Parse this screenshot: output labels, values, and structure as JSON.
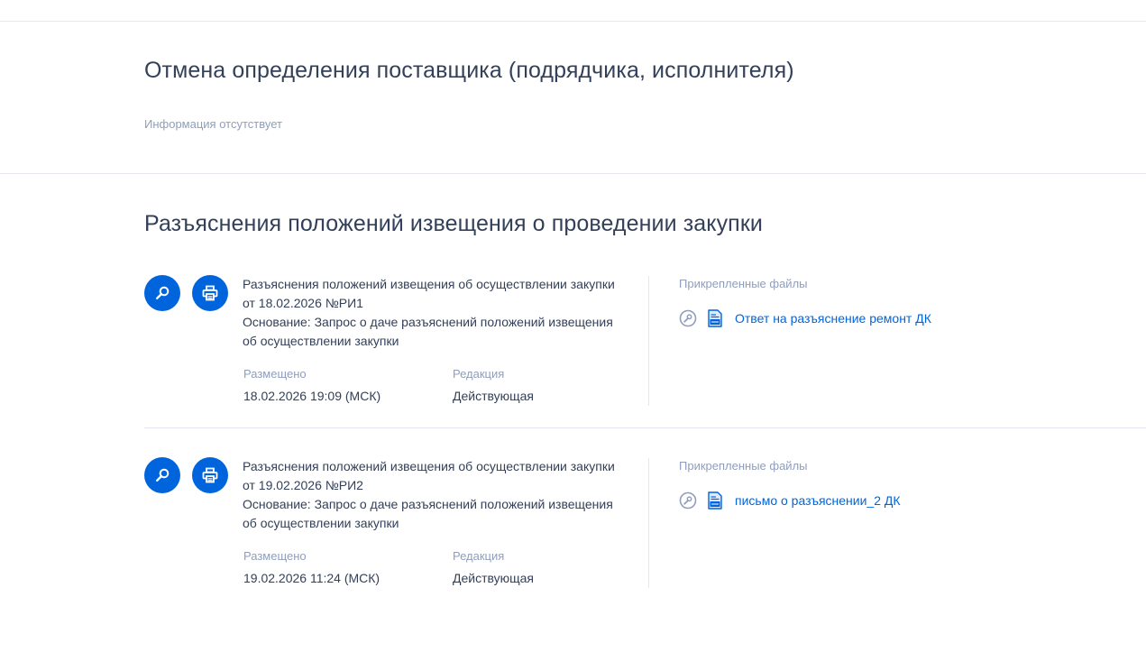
{
  "cancel_section": {
    "title": "Отмена определения поставщика (подрядчика, исполнителя)",
    "empty_text": "Информация отсутствует"
  },
  "clarifications_section": {
    "title": "Разъяснения положений извещения о проведении закупки",
    "labels": {
      "placed": "Размещено",
      "edition": "Редакция",
      "attached_files": "Прикрепленные файлы"
    },
    "items": [
      {
        "title_line1": "Разъяснения положений извещения об осуществлении закупки",
        "title_line2": "от 18.02.2026 №РИ1",
        "basis_line1": "Основание: Запрос о даче разъяснений положений извещения",
        "basis_line2": "об осуществлении закупки",
        "placed": "18.02.2026 19:09 (МСК)",
        "edition": "Действующая",
        "file_name": "Ответ на разъяснение ремонт ДК"
      },
      {
        "title_line1": "Разъяснения положений извещения об осуществлении закупки",
        "title_line2": "от 19.02.2026 №РИ2",
        "basis_line1": "Основание: Запрос о даче разъяснений положений извещения",
        "basis_line2": "об осуществлении закупки",
        "placed": "19.02.2026 11:24 (МСК)",
        "edition": "Действующая",
        "file_name": "письмо о разъяснении_2 ДК"
      }
    ]
  },
  "icons": {
    "view": "magnifier-icon",
    "print": "printer-icon",
    "signature": "signature-icon",
    "document": "document-icon"
  },
  "colors": {
    "accent": "#0065dd",
    "text": "#334059",
    "muted": "#909ebb",
    "divider": "#e4e7f2"
  }
}
